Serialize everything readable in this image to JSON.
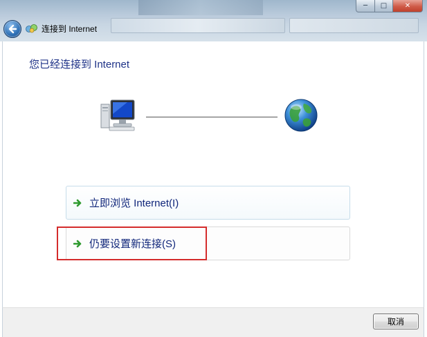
{
  "window": {
    "title": "连接到 Internet",
    "controls": {
      "minimize": "─",
      "maximize": "□",
      "close": "✕"
    }
  },
  "main": {
    "heading": "您已经连接到 Internet",
    "status_icons": [
      "computer-icon",
      "globe-icon"
    ],
    "options": [
      {
        "label": "立即浏览 Internet(I)",
        "icon": "green-arrow-icon"
      },
      {
        "label": "仍要设置新连接(S)",
        "icon": "green-arrow-icon",
        "highlighted": true
      }
    ]
  },
  "footer": {
    "cancel_label": "取消"
  },
  "colors": {
    "heading": "#1e3287",
    "link": "#10267a",
    "arrow": "#2e9a2e",
    "highlight": "#d42b2b"
  }
}
